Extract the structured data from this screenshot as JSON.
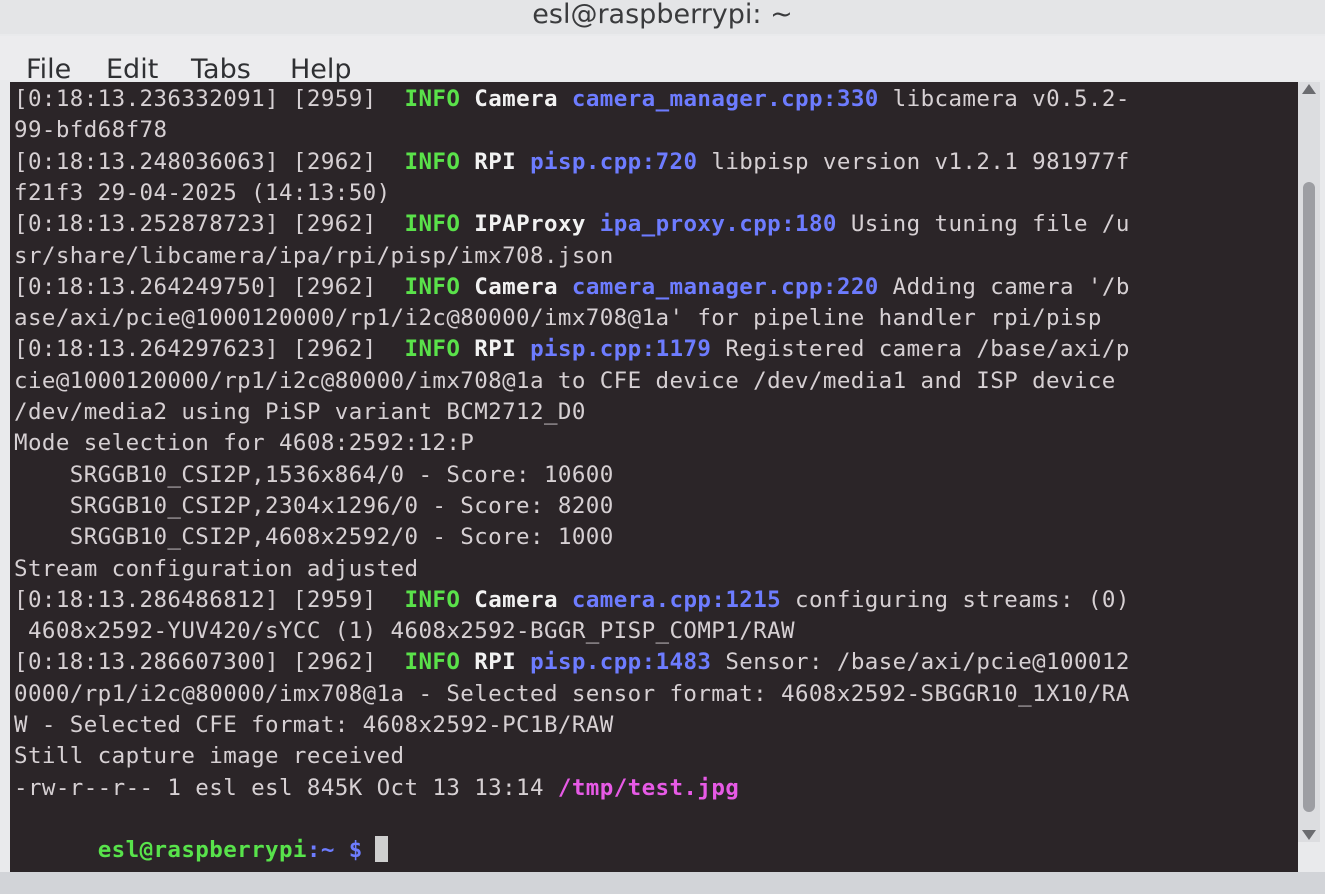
{
  "window": {
    "title": "esl@raspberrypi: ~"
  },
  "menu": {
    "items": [
      "File",
      "Edit",
      "Tabs",
      "Help"
    ]
  },
  "terminal": {
    "log": [
      {
        "ts": "[0:18:13.236332091] [2959]",
        "level": "INFO",
        "comp": "Camera",
        "src": "camera_manager.cpp:330",
        "msg": " libcamera v0.5.2-"
      },
      {
        "plain": "99-bfd68f78"
      },
      {
        "ts": "[0:18:13.248036063] [2962]",
        "level": "INFO",
        "comp": "RPI",
        "src": "pisp.cpp:720",
        "msg": " libpisp version v1.2.1 981977f"
      },
      {
        "plain": "f21f3 29-04-2025 (14:13:50)"
      },
      {
        "ts": "[0:18:13.252878723] [2962]",
        "level": "INFO",
        "comp": "IPAProxy",
        "src": "ipa_proxy.cpp:180",
        "msg": " Using tuning file /u"
      },
      {
        "plain": "sr/share/libcamera/ipa/rpi/pisp/imx708.json"
      },
      {
        "ts": "[0:18:13.264249750] [2962]",
        "level": "INFO",
        "comp": "Camera",
        "src": "camera_manager.cpp:220",
        "msg": " Adding camera '/b"
      },
      {
        "plain": "ase/axi/pcie@1000120000/rp1/i2c@80000/imx708@1a' for pipeline handler rpi/pisp"
      },
      {
        "ts": "[0:18:13.264297623] [2962]",
        "level": "INFO",
        "comp": "RPI",
        "src": "pisp.cpp:1179",
        "msg": " Registered camera /base/axi/p"
      },
      {
        "plain": "cie@1000120000/rp1/i2c@80000/imx708@1a to CFE device /dev/media1 and ISP device"
      },
      {
        "plain": "/dev/media2 using PiSP variant BCM2712_D0"
      },
      {
        "plain": "Mode selection for 4608:2592:12:P"
      },
      {
        "plain": "    SRGGB10_CSI2P,1536x864/0 - Score: 10600"
      },
      {
        "plain": "    SRGGB10_CSI2P,2304x1296/0 - Score: 8200"
      },
      {
        "plain": "    SRGGB10_CSI2P,4608x2592/0 - Score: 1000"
      },
      {
        "plain": "Stream configuration adjusted"
      },
      {
        "ts": "[0:18:13.286486812] [2959]",
        "level": "INFO",
        "comp": "Camera",
        "src": "camera.cpp:1215",
        "msg": " configuring streams: (0)"
      },
      {
        "plain": " 4608x2592-YUV420/sYCC (1) 4608x2592-BGGR_PISP_COMP1/RAW"
      },
      {
        "ts": "[0:18:13.286607300] [2962]",
        "level": "INFO",
        "comp": "RPI",
        "src": "pisp.cpp:1483",
        "msg": " Sensor: /base/axi/pcie@100012"
      },
      {
        "plain": "0000/rp1/i2c@80000/imx708@1a - Selected sensor format: 4608x2592-SBGGR10_1X10/RA"
      },
      {
        "plain": "W - Selected CFE format: 4608x2592-PC1B/RAW"
      },
      {
        "plain": "Still capture image received"
      },
      {
        "pre": "-rw-r--r-- 1 esl esl 845K Oct 13 13:14 ",
        "path": "/tmp/test.jpg"
      }
    ],
    "prompt": {
      "user": "esl@raspberrypi",
      "path": ":~ $",
      "command": ""
    }
  }
}
